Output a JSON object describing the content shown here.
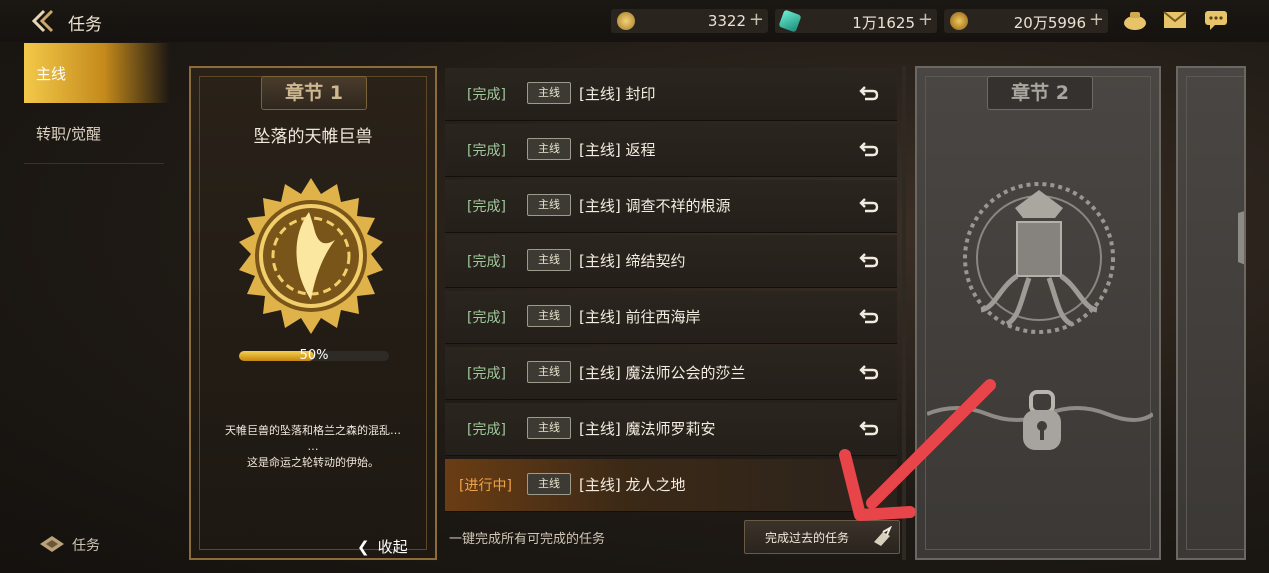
{
  "header": {
    "title": "任务",
    "currencies": [
      {
        "name": "gold-coin",
        "value": "3322"
      },
      {
        "name": "gem",
        "value": "1万1625"
      },
      {
        "name": "coin",
        "value": "20万5996"
      }
    ],
    "plus": "+"
  },
  "sidebar": {
    "items": [
      {
        "label": "主线",
        "active": true
      },
      {
        "label": "转职/觉醒",
        "active": false
      }
    ],
    "bottom_label": "任务"
  },
  "chapter1": {
    "head": "章节 1",
    "name": "坠落的天帷巨兽",
    "progress_text": "50%",
    "progress": 0.5,
    "desc_line1": "天帷巨兽的坠落和格兰之森的混乱…",
    "desc_line2": "…",
    "desc_line3": "这是命运之轮转动的伊始。",
    "collapse": "收起"
  },
  "quests": [
    {
      "status": "[完成]",
      "tag": "主线",
      "name": "[主线] 封印"
    },
    {
      "status": "[完成]",
      "tag": "主线",
      "name": "[主线] 返程"
    },
    {
      "status": "[完成]",
      "tag": "主线",
      "name": "[主线] 调查不祥的根源"
    },
    {
      "status": "[完成]",
      "tag": "主线",
      "name": "[主线] 缔结契约"
    },
    {
      "status": "[完成]",
      "tag": "主线",
      "name": "[主线] 前往西海岸"
    },
    {
      "status": "[完成]",
      "tag": "主线",
      "name": "[主线] 魔法师公会的莎兰"
    },
    {
      "status": "[完成]",
      "tag": "主线",
      "name": "[主线] 魔法师罗莉安"
    },
    {
      "status": "[进行中]",
      "tag": "主线",
      "name": "[主线] 龙人之地"
    }
  ],
  "footer": {
    "oneclick": "一键完成所有可完成的任务",
    "done_button": "完成过去的任务"
  },
  "chapter2": {
    "head": "章节 2"
  },
  "colors": {
    "accent": "#f3c94a",
    "complete": "#9ec89a",
    "in_progress": "#f0a44a",
    "annotation": "#e8454a"
  }
}
